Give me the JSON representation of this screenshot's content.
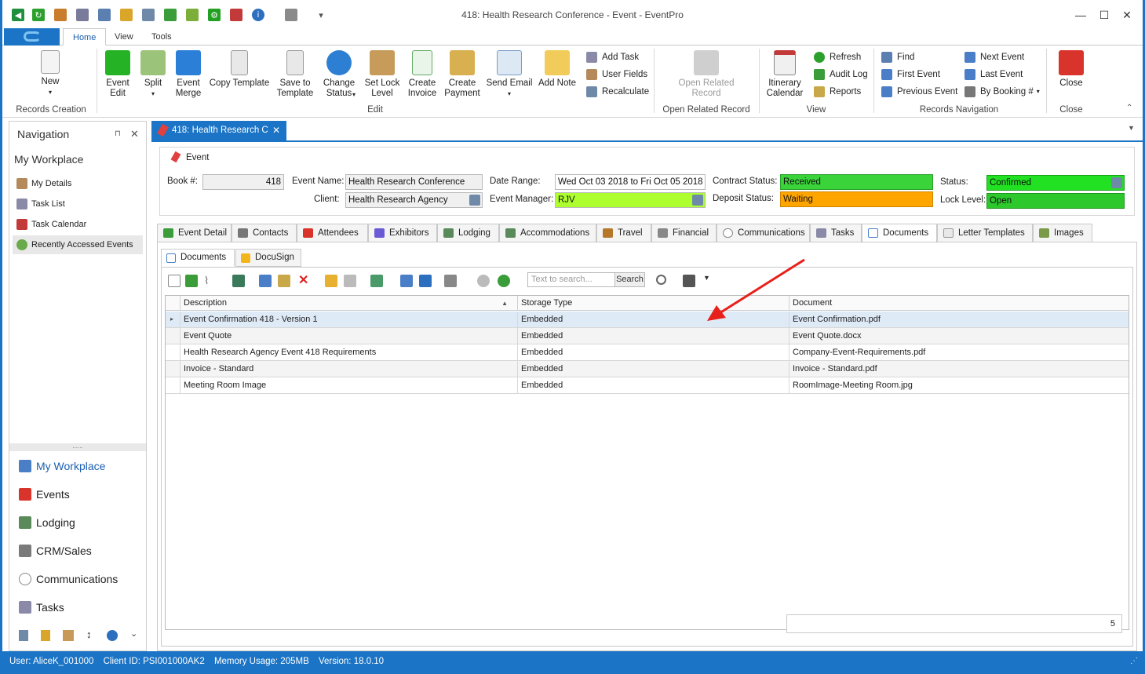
{
  "window": {
    "title": "418: Health Research Conference - Event - EventPro"
  },
  "ribbon_tabs": [
    "Home",
    "View",
    "Tools"
  ],
  "ribbon": {
    "new": "New",
    "records_creation": "Records Creation",
    "event_edit": "Event\nEdit",
    "split": "Split",
    "event_merge": "Event\nMerge",
    "copy_template": "Copy Template",
    "save_to_template": "Save to\nTemplate",
    "change_status": "Change\nStatus",
    "set_lock_level": "Set Lock\nLevel",
    "create_invoice": "Create\nInvoice",
    "create_payment": "Create\nPayment",
    "send_email": "Send Email",
    "add_note": "Add Note",
    "add_task": "Add Task",
    "user_fields": "User Fields",
    "recalculate": "Recalculate",
    "edit_group": "Edit",
    "open_related_record": "Open Related\nRecord",
    "open_related_group": "Open Related Record",
    "itinerary_calendar": "Itinerary\nCalendar",
    "refresh": "Refresh",
    "audit_log": "Audit Log",
    "reports": "Reports",
    "view_group": "View",
    "find": "Find",
    "first_event": "First Event",
    "previous_event": "Previous Event",
    "next_event": "Next Event",
    "last_event": "Last Event",
    "by_booking": "By Booking #",
    "records_navigation": "Records Navigation",
    "close": "Close",
    "close_group": "Close"
  },
  "navigation": {
    "title": "Navigation",
    "workplace": "My Workplace",
    "items": [
      "My Details",
      "Task List",
      "Task Calendar",
      "Recently Accessed Events"
    ],
    "big_items": [
      "My Workplace",
      "Events",
      "Lodging",
      "CRM/Sales",
      "Communications",
      "Tasks"
    ]
  },
  "doc_tab": {
    "label": "418: Health Research C"
  },
  "event": {
    "section_label": "Event",
    "book_label": "Book #:",
    "book_value": "418",
    "event_name_label": "Event Name:",
    "event_name_value": "Health Research Conference",
    "client_label": "Client:",
    "client_value": "Health Research Agency",
    "date_range_label": "Date Range:",
    "date_range_value": "Wed Oct 03 2018 to Fri Oct 05 2018",
    "event_manager_label": "Event Manager:",
    "event_manager_value": "RJV",
    "contract_status_label": "Contract Status:",
    "contract_status_value": "Received",
    "deposit_status_label": "Deposit Status:",
    "deposit_status_value": "Waiting",
    "status_label": "Status:",
    "status_value": "Confirmed",
    "lock_level_label": "Lock Level:",
    "lock_level_value": "Open"
  },
  "tabs": [
    "Event Detail",
    "Contacts",
    "Attendees",
    "Exhibitors",
    "Lodging",
    "Accommodations",
    "Travel",
    "Financial",
    "Communications",
    "Tasks",
    "Documents",
    "Letter Templates",
    "Images"
  ],
  "subtabs": [
    "Documents",
    "DocuSign"
  ],
  "search": {
    "placeholder": "Text to search...",
    "button": "Search"
  },
  "grid": {
    "columns": [
      "Description",
      "Storage Type",
      "Document"
    ],
    "rows": [
      [
        "Event Confirmation 418 - Version 1",
        "Embedded",
        "Event Confirmation.pdf"
      ],
      [
        "Event Quote",
        "Embedded",
        "Event Quote.docx"
      ],
      [
        "Health Research Agency Event 418 Requirements",
        "Embedded",
        "Company-Event-Requirements.pdf"
      ],
      [
        "Invoice - Standard",
        "Embedded",
        "Invoice - Standard.pdf"
      ],
      [
        "Meeting Room Image",
        "Embedded",
        "RoomImage-Meeting Room.jpg"
      ]
    ],
    "count": "5"
  },
  "status_bar": {
    "user": "User: AliceK_001000",
    "client_id": "Client ID: PSI001000AK2",
    "memory": "Memory Usage: 205MB",
    "version": "Version: 18.0.10"
  },
  "colors": {
    "brand": "#1b74c5",
    "received": "#3ad33a",
    "waiting": "#ffa500",
    "confirmed": "#22e022",
    "open": "#2cc82c",
    "manager": "#adff2f",
    "arrow": "#e8201b"
  }
}
